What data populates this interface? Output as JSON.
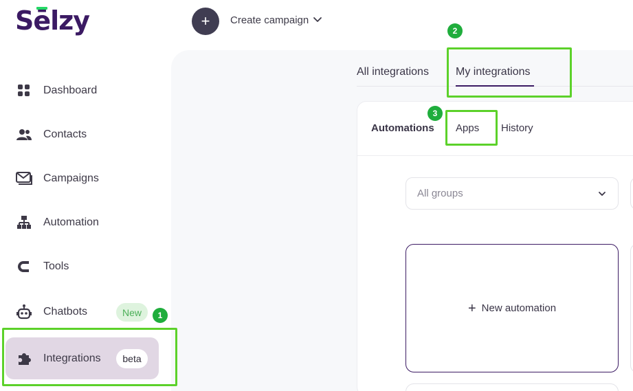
{
  "brand": {
    "logo_text": "Sēlzy",
    "accent": "#3b1a63",
    "logo_bar": "#25d866"
  },
  "header": {
    "create_icon": "+",
    "create_label": "Create campaign"
  },
  "sidebar": {
    "items": [
      {
        "label": "Dashboard",
        "icon": "grid-icon"
      },
      {
        "label": "Contacts",
        "icon": "people-icon"
      },
      {
        "label": "Campaigns",
        "icon": "envelope-icon"
      },
      {
        "label": "Automation",
        "icon": "hierarchy-icon"
      },
      {
        "label": "Tools",
        "icon": "magnet-icon"
      },
      {
        "label": "Chatbots",
        "icon": "robot-icon",
        "badge": "New"
      },
      {
        "label": "Integrations",
        "icon": "puzzle-icon",
        "badge": "beta",
        "active": true
      }
    ]
  },
  "integrations": {
    "tabs": [
      {
        "label": "All integrations"
      },
      {
        "label": "My integrations",
        "active": true
      }
    ],
    "sub_tabs": [
      {
        "label": "Automations"
      },
      {
        "label": "Apps"
      },
      {
        "label": "History"
      }
    ],
    "group_select": {
      "value": "All groups"
    },
    "new_automation": {
      "icon": "+",
      "label": "New automation"
    }
  },
  "annotations": {
    "steps": [
      "1",
      "2",
      "3"
    ],
    "highlight_color": "#5cd12a",
    "step_color": "#1fad3c"
  }
}
